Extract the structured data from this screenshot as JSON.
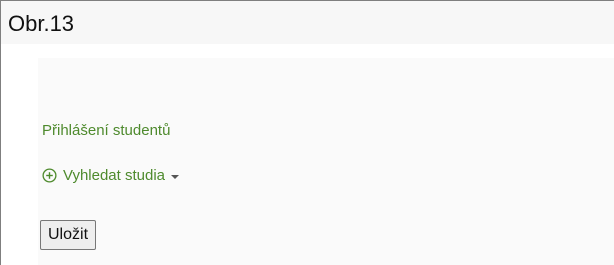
{
  "caption": {
    "title": "Obr.13"
  },
  "content": {
    "section_title": "Přihlášení studentů",
    "search_link_label": "Vyhledat studia",
    "save_label": "Uložit"
  },
  "colors": {
    "link_green": "#4e8a2d",
    "caption_background": "#f7f7f7"
  },
  "icons": {
    "add": "plus-circle-icon",
    "dropdown": "chevron-down-icon"
  }
}
